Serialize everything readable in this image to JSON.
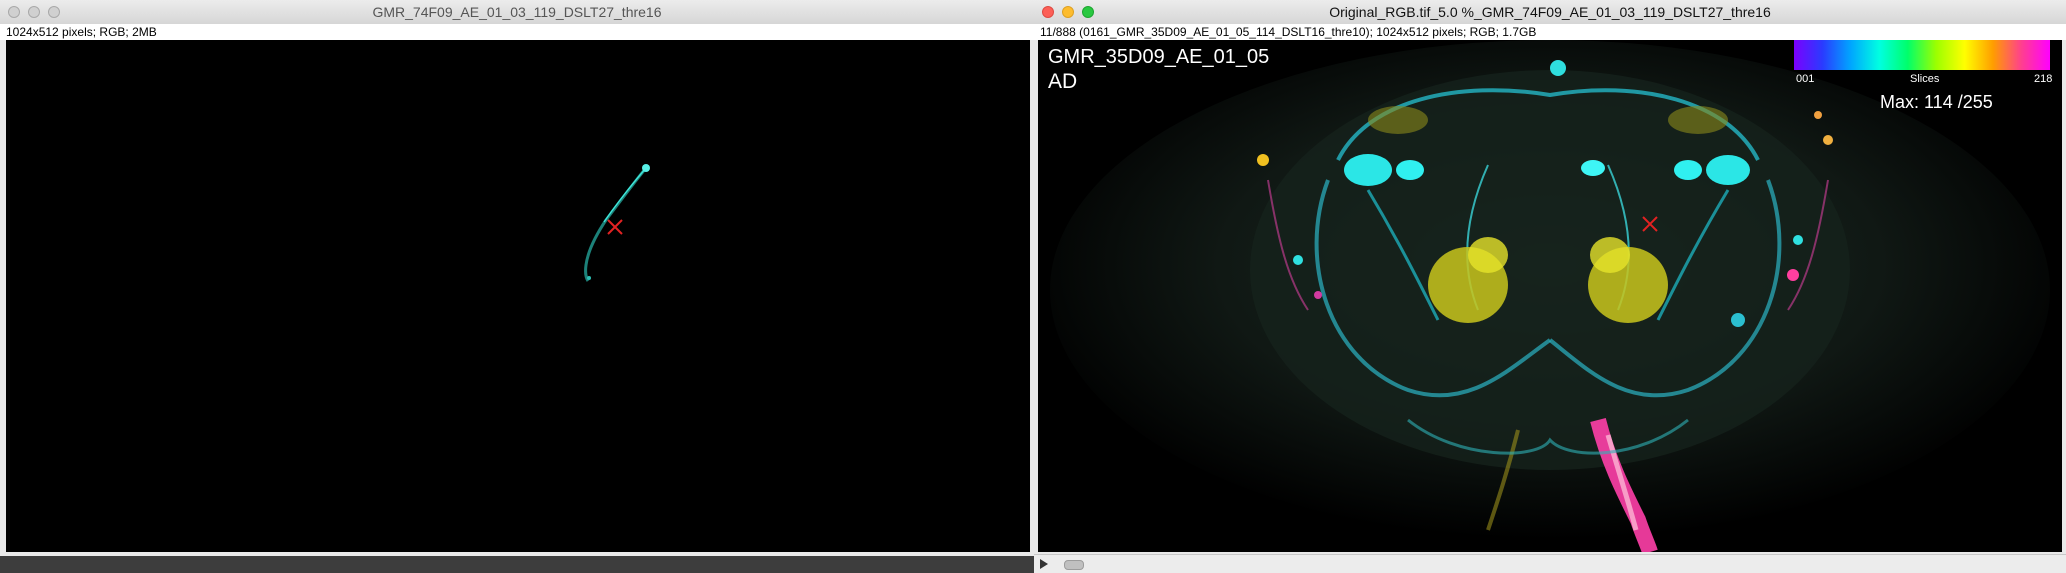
{
  "left_window": {
    "title": "GMR_74F09_AE_01_03_119_DSLT27_thre16",
    "info": "1024x512 pixels; RGB; 2MB"
  },
  "right_window": {
    "title": "Original_RGB.tif_5.0 %_GMR_74F09_AE_01_03_119_DSLT27_thre16",
    "info": "11/888 (0161_GMR_35D09_AE_01_05_114_DSLT16_thre10); 1024x512 pixels; RGB; 1.7GB",
    "overlay": {
      "name": "GMR_35D09_AE_01_05",
      "view": "AD",
      "max": "Max: 114 /255"
    },
    "lut": {
      "low": "001",
      "label": "Slices",
      "high": "218"
    }
  },
  "colors": {
    "marker": "#e22222",
    "lut_start": "#7b00ff",
    "lut_end": "#ff00ff"
  }
}
